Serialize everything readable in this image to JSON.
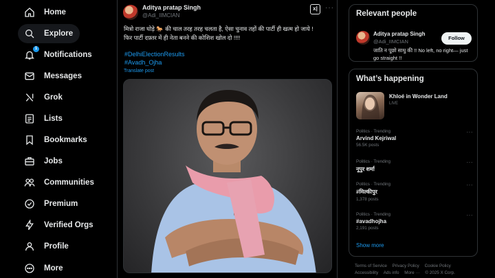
{
  "nav": {
    "items": [
      {
        "label": "Home",
        "icon": "home-icon"
      },
      {
        "label": "Explore",
        "icon": "search-icon"
      },
      {
        "label": "Notifications",
        "icon": "bell-icon",
        "badge": "1"
      },
      {
        "label": "Messages",
        "icon": "envelope-icon"
      },
      {
        "label": "Grok",
        "icon": "grok-icon"
      },
      {
        "label": "Lists",
        "icon": "list-icon"
      },
      {
        "label": "Bookmarks",
        "icon": "bookmark-icon"
      },
      {
        "label": "Jobs",
        "icon": "briefcase-icon"
      },
      {
        "label": "Communities",
        "icon": "people-icon"
      },
      {
        "label": "Premium",
        "icon": "x-premium-icon"
      },
      {
        "label": "Verified Orgs",
        "icon": "lightning-icon"
      },
      {
        "label": "Profile",
        "icon": "person-icon"
      },
      {
        "label": "More",
        "icon": "more-circle-icon"
      }
    ],
    "active": "Explore"
  },
  "post": {
    "author_name": "Aditya pratap Singh",
    "author_handle": "@Adi_IIMCIAN",
    "grok_label": "x|",
    "more_label": "···",
    "text_line1": "मित्रो राजा घोड़े 🐎 की चाल तरह तरह चलता है, ऐसा चुनाव तहों की पार्टी ही खत्म हो जाये !",
    "text_line2": "फिर पार्टी दफ़्तर में ही नेता बनने की कोशिश खोल दो !!!!",
    "hashtag1": "#DelhiElectionResults",
    "hashtag2": "#Avadh_Ojha",
    "translate_label": "Translate post"
  },
  "relevant_people": {
    "title": "Relevant people",
    "name": "Aditya pratap Singh",
    "handle": "@Adi_IIMCIAN",
    "follow_label": "Follow",
    "bio": "जाति न पूछो साधु की !! No left, no right— just go straight !!"
  },
  "whats_happening": {
    "title": "What’s happening",
    "live_name": "Khloé in Wonder Land",
    "live_tag": "LIVE",
    "trends": [
      {
        "meta": "Politics · Trending",
        "name": "Arvind Kejriwal",
        "count": "56.5K posts"
      },
      {
        "meta": "Politics · Trending",
        "name": "नूपुर शर्मा",
        "count": ""
      },
      {
        "meta": "Politics · Trending",
        "name": "#मिल्कीपुर",
        "count": "1,378 posts"
      },
      {
        "meta": "Politics · Trending",
        "name": "#avadhojha",
        "count": "2,191 posts"
      }
    ],
    "show_more": "Show more"
  },
  "footer": {
    "line1": [
      "Terms of Service",
      "Privacy Policy",
      "Cookie Policy"
    ],
    "line2": [
      "Accessibility",
      "Ads info",
      "More ···",
      "© 2025 X Corp."
    ]
  },
  "colors": {
    "accent": "#1d9bf0",
    "background": "#000000",
    "border": "#2f3336",
    "text": "#e7e9ea",
    "muted": "#71767b"
  }
}
